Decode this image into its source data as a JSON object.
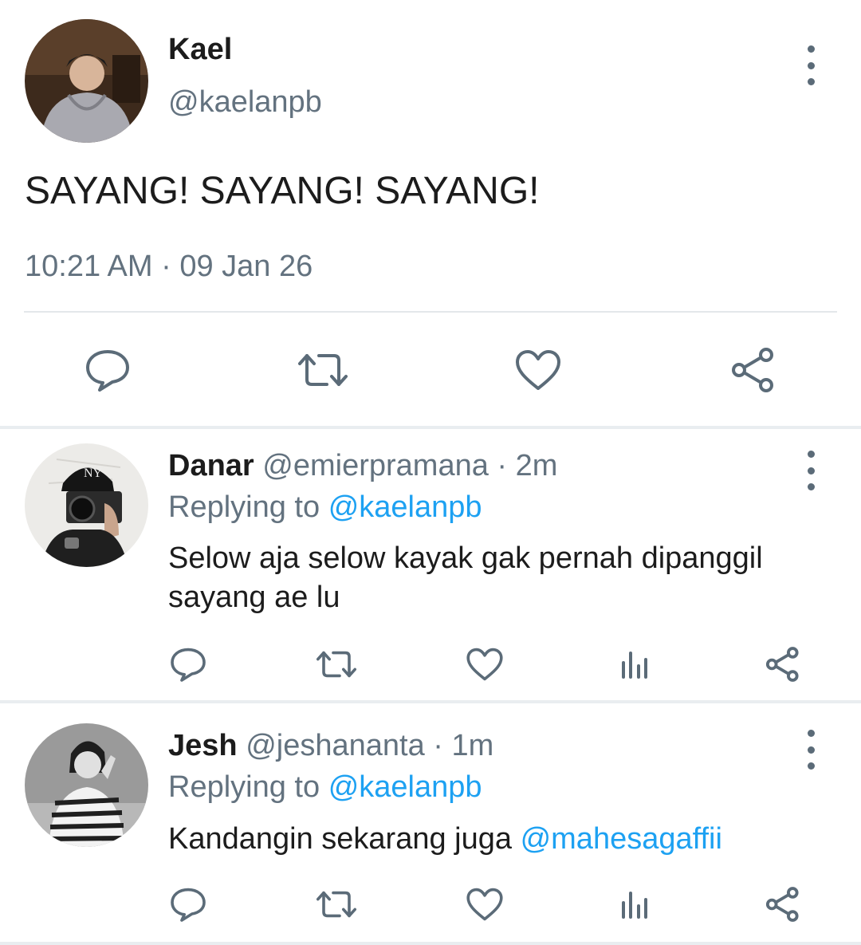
{
  "tweet": {
    "name": "Kael",
    "handle": "@kaelanpb",
    "text": "SAYANG! SAYANG! SAYANG!",
    "timestamp": "10:21 AM · 09 Jan 26"
  },
  "replies": [
    {
      "name": "Danar",
      "handle_time": "@emierpramana · 2m",
      "replying_prefix": "Replying to",
      "replying_handle": "@kaelanpb",
      "text_line1": "Selow aja selow kayak gak pernah dipanggil",
      "text_line2": "sayang ae lu"
    },
    {
      "name": "Jesh",
      "handle_time": "@jeshananta · 1m",
      "replying_prefix": "Replying to",
      "replying_handle": "@kaelanpb",
      "text": "Kandangin sekarang juga ",
      "mention": "@mahesagaffii"
    }
  ],
  "icons": {
    "reply": "speech-bubble-icon",
    "retweet": "retweet-icon",
    "like": "heart-icon",
    "analytics": "bar-chart-icon",
    "share": "share-icon",
    "more": "vertical-ellipsis-icon"
  },
  "colors": {
    "link": "#1da1f2",
    "icon": "#5b6b78",
    "secondary_text": "#63727f",
    "divider": "#e9edf0"
  }
}
